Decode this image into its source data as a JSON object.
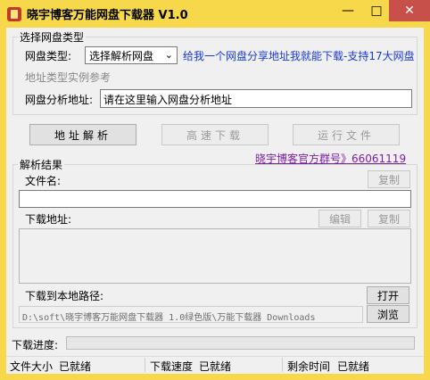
{
  "window": {
    "title": "晓宇博客万能网盘下载器 V1.0",
    "min_glyph": "—",
    "max_glyph": "□",
    "close_glyph": "✕",
    "title_color": "#f6d84a",
    "close_color": "#c7504b"
  },
  "type_group": {
    "title": "选择网盘类型",
    "type_label": "网盘类型:",
    "type_selected": "选择解析网盘",
    "promo_text": "给我一个网盘分享地址我就能下载-支持17大网盘",
    "example_text": "地址类型实例参考",
    "address_label": "网盘分析地址:",
    "address_value": "请在这里输入网盘分析地址"
  },
  "actions": {
    "parse": "地址解析",
    "fast_download": "高速下载",
    "run_file": "运行文件",
    "group_link": "晓宇博客官方群号》66061119"
  },
  "result_group": {
    "title": "解析结果",
    "filename_label": "文件名:",
    "copy_label": "复制",
    "download_label": "下载地址:",
    "edit_label": "编辑",
    "copy2_label": "复制",
    "filename_value": "",
    "download_value": ""
  },
  "local": {
    "path_label": "下载到本地路径:",
    "open_label": "打开",
    "path_value": "D:\\soft\\晓宇博客万能网盘下载器 1.0绿色版\\万能下载器_Downloads",
    "browse_label": "浏览"
  },
  "progress": {
    "label": "下载进度:",
    "value": 0
  },
  "status": {
    "size_label": "文件大小",
    "size_value": "已就绪",
    "speed_label": "下载速度",
    "speed_value": "已就绪",
    "remaining_label": "剩余时间",
    "remaining_value": "已就绪"
  }
}
